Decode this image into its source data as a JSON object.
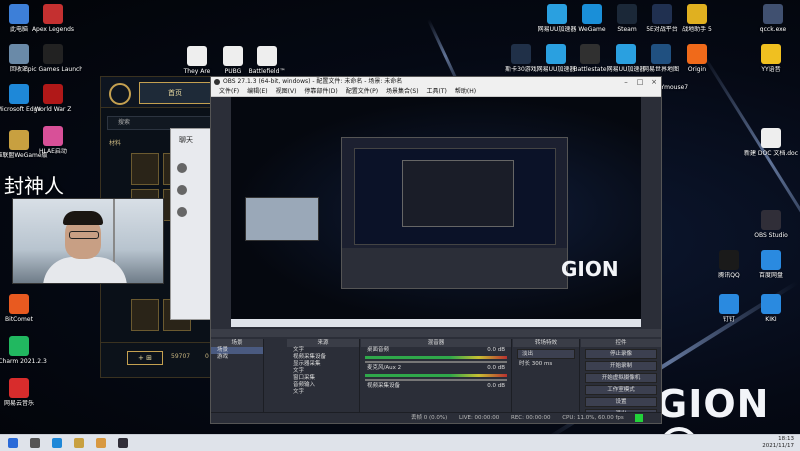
{
  "desktop_icons_left": [
    {
      "label": "此电脑",
      "icon": "computer-icon",
      "color": "#3d7fd8"
    },
    {
      "label": "回收站",
      "icon": "recycle-bin-icon",
      "color": "#6a8aa8"
    },
    {
      "label": "Microsoft Edge",
      "icon": "edge-icon",
      "color": "#1e88d8"
    },
    {
      "label": "英雄联盟WeGame版",
      "icon": "lol-icon",
      "color": "#c8a040"
    },
    {
      "label": "BitComet",
      "icon": "bitcomet-icon",
      "color": "#e85a20"
    },
    {
      "label": "PyCharm 2021.2.3",
      "icon": "pycharm-icon",
      "color": "#21b860"
    },
    {
      "label": "网易云音乐",
      "icon": "netease-music-icon",
      "color": "#d82c2c"
    }
  ],
  "desktop_icons_left2": [
    {
      "label": "Apex Legends",
      "icon": "apex-icon",
      "color": "#c43030"
    },
    {
      "label": "Epic Games Launcher",
      "icon": "epic-icon",
      "color": "#222222"
    },
    {
      "label": "World War Z",
      "icon": "wwz-icon",
      "color": "#b01818"
    },
    {
      "label": "HLAE启动",
      "icon": "hlae-icon",
      "color": "#d85098"
    }
  ],
  "desktop_icons_top": [
    {
      "label": "They Are",
      "icon": "file-icon",
      "color": "#eeeeee"
    },
    {
      "label": "PUBG",
      "icon": "file-icon",
      "color": "#eeeeee"
    },
    {
      "label": "Battlefield™",
      "icon": "file-icon",
      "color": "#eeeeee"
    }
  ],
  "desktop_icons_right_top": [
    {
      "label": "网易UU加速器",
      "icon": "uu-icon",
      "color": "#2aa0e0"
    },
    {
      "label": "WeGame",
      "icon": "wegame-icon",
      "color": "#1a8fd8"
    },
    {
      "label": "Steam",
      "icon": "steam-icon",
      "color": "#1b2838"
    },
    {
      "label": "5E对战平台",
      "icon": "5e-icon",
      "color": "#203050"
    },
    {
      "label": "战地助手 5",
      "icon": "bf-helper-icon",
      "color": "#e0b020"
    },
    {
      "label": "qcck.exe",
      "icon": "exe-icon",
      "color": "#405070"
    }
  ],
  "desktop_icons_right_row2": [
    {
      "label": "斯卡30游戏",
      "icon": "game-icon",
      "color": "#203048"
    },
    {
      "label": "网易UU加速器",
      "icon": "uu-icon",
      "color": "#2aa0e0"
    },
    {
      "label": "Battlestate",
      "icon": "bsg-icon",
      "color": "#303030"
    },
    {
      "label": "网易UU加速器",
      "icon": "uu-icon",
      "color": "#2aa0e0"
    },
    {
      "label": "网易世界地图",
      "icon": "map-icon",
      "color": "#205080"
    },
    {
      "label": "Origin",
      "icon": "origin-icon",
      "color": "#f06a1a"
    },
    {
      "label": "YY语音",
      "icon": "yy-icon",
      "color": "#f0c020"
    }
  ],
  "desktop_icons_right_col": [
    {
      "label": "新建 DOC 文档.doc",
      "icon": "doc-icon",
      "color": "#eeeeee"
    },
    {
      "label": "OBS Studio",
      "icon": "obs-icon",
      "color": "#302e38"
    },
    {
      "label": "百度网盘",
      "icon": "baidu-pan-icon",
      "color": "#2a8ae0"
    },
    {
      "label": "钉钉",
      "icon": "dingtalk-icon",
      "color": "#2a8ae0"
    },
    {
      "label": "腾讯QQ",
      "icon": "qq-icon",
      "color": "#1a1a1a"
    },
    {
      "label": "KIKI",
      "icon": "kiki-icon",
      "color": "#2a8ae0"
    }
  ],
  "mouse_label": "NYmouse7",
  "game_client": {
    "home_button": "首页",
    "search_placeholder": "搜索",
    "category": "材料",
    "plus_label": "+ ⊞",
    "coin_a": "59707",
    "coin_b": "0"
  },
  "chat_window": {
    "title": "聊天"
  },
  "overlay_text": "封神人",
  "obs": {
    "title": "OBS 27.1.3 (64-bit, windows) - 配置文件: 未命名 - 场景: 未命名",
    "menu": [
      "文件(F)",
      "编辑(E)",
      "视图(V)",
      "停靠部件(D)",
      "配置文件(P)",
      "场景集合(S)",
      "工具(T)",
      "帮助(H)"
    ],
    "docks": {
      "scenes": {
        "title": "场景",
        "items": [
          "场景",
          "游戏"
        ]
      },
      "sources": {
        "title": "来源",
        "items": [
          "文字",
          "视频采集设备",
          "显示器采集",
          "文字",
          "窗口采集",
          "音频输入",
          "文字"
        ]
      },
      "mixer": {
        "title": "混音器",
        "channels": [
          {
            "name": "桌面音频",
            "db": "0.0 dB"
          },
          {
            "name": "麦克风/Aux 2",
            "db": "0.0 dB"
          },
          {
            "name": "视频采集设备",
            "db": "0.0 dB"
          }
        ]
      },
      "transitions": {
        "title": "转场特效",
        "type": "淡出",
        "duration_label": "时长",
        "duration": "300 ms"
      },
      "controls": {
        "title": "控件",
        "buttons": [
          "停止录像",
          "开始录制",
          "开始虚拟摄像机",
          "工作室模式",
          "设置",
          "退出"
        ]
      }
    },
    "status": {
      "dropped": "丢帧 0 (0.0%)",
      "live": "LIVE: 00:00:00",
      "rec": "REC: 00:00:00",
      "cpu": "CPU: 11.0%, 60.00 fps"
    }
  },
  "brand_logo": "GION",
  "clock": {
    "time": "18:13",
    "date": "2021/11/17"
  },
  "taskbar_icons": [
    {
      "icon": "windows-start-icon",
      "color": "#2a6ad8"
    },
    {
      "icon": "search-icon",
      "color": "#555555"
    },
    {
      "icon": "edge-icon",
      "color": "#1e88d8"
    },
    {
      "icon": "lol-icon",
      "color": "#c8a040"
    },
    {
      "icon": "hand-icon",
      "color": "#d89840"
    },
    {
      "icon": "obs-icon",
      "color": "#302e38"
    }
  ]
}
